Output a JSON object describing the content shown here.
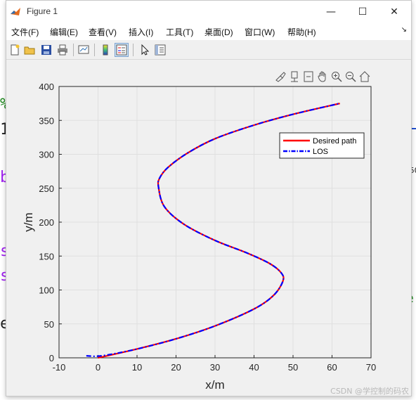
{
  "window": {
    "title": "Figure 1",
    "controls": {
      "minimize": "—",
      "maximize": "☐",
      "close": "✕"
    }
  },
  "menu": {
    "items": [
      "文件(F)",
      "编辑(E)",
      "查看(V)",
      "插入(I)",
      "工具(T)",
      "桌面(D)",
      "窗口(W)",
      "帮助(H)"
    ],
    "overflow": "↘"
  },
  "toolbar": {
    "icons": [
      "new-figure-icon",
      "open-file-icon",
      "save-icon",
      "print-icon",
      "link-plot-icon",
      "insert-colorbar-icon",
      "insert-legend-icon",
      "edit-plot-icon",
      "property-inspector-icon"
    ]
  },
  "axes_toolbar": {
    "icons": [
      "brush-icon",
      "data-tips-icon",
      "restore-view-icon",
      "pan-icon",
      "zoom-in-icon",
      "zoom-out-icon",
      "home-icon"
    ]
  },
  "background_fragments": [
    "%",
    "1",
    "b",
    "s",
    "s",
    "e",
    "e",
    "50"
  ],
  "colors": {
    "desired": "#ff0000",
    "los": "#0000ff",
    "grid": "#dfdfdf"
  },
  "chart_data": {
    "type": "line",
    "title": "",
    "xlabel": "x/m",
    "ylabel": "y/m",
    "xlim": [
      -10,
      70
    ],
    "ylim": [
      0,
      400
    ],
    "xticks": [
      -10,
      0,
      10,
      20,
      30,
      40,
      50,
      60,
      70
    ],
    "yticks": [
      0,
      50,
      100,
      150,
      200,
      250,
      300,
      350,
      400
    ],
    "grid": true,
    "legend_position": "top-right",
    "series": [
      {
        "name": "Desired path",
        "style": "solid",
        "x": [
          0,
          10,
          20,
          30,
          40,
          45,
          47.4,
          47,
          44,
          38,
          30,
          22,
          17,
          15.5,
          15.8,
          18,
          23,
          30,
          40,
          50,
          62
        ],
        "y": [
          0,
          13,
          28,
          47,
          72,
          92,
          113,
          125,
          139,
          155,
          173,
          197,
          223,
          252,
          265,
          281,
          302,
          323,
          343,
          359,
          375
        ]
      },
      {
        "name": "LOS",
        "style": "dash-dot",
        "x": [
          -3,
          1,
          10,
          20,
          30,
          40,
          45,
          47.4,
          47,
          44,
          38,
          30,
          22,
          17,
          15.5,
          15.8,
          18,
          23,
          30,
          40,
          50,
          62
        ],
        "y": [
          3,
          3,
          13,
          28,
          47,
          72,
          92,
          113,
          125,
          139,
          155,
          173,
          197,
          223,
          252,
          265,
          281,
          302,
          323,
          343,
          359,
          375
        ]
      }
    ]
  },
  "watermark": "CSDN @学控制的码农"
}
